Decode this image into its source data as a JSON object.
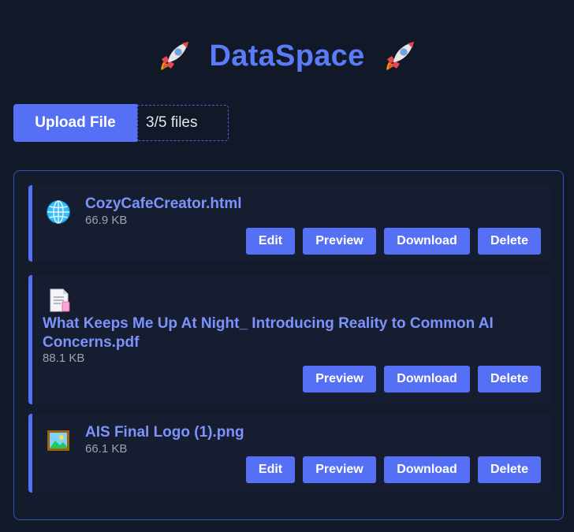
{
  "app": {
    "title": "DataSpace",
    "title_left_icon": "rocket-icon",
    "title_right_icon": "rocket-icon"
  },
  "upload": {
    "button_label": "Upload File",
    "file_count": "3/5 files"
  },
  "files": [
    {
      "icon": "globe-icon",
      "name": "CozyCafeCreator.html",
      "size": "66.9 KB",
      "actions": [
        "Edit",
        "Preview",
        "Download",
        "Delete"
      ]
    },
    {
      "icon": "document-icon",
      "name": "What Keeps Me Up At Night_ Introducing Reality to Common AI Concerns.pdf",
      "size": "88.1 KB",
      "actions": [
        "Preview",
        "Download",
        "Delete"
      ]
    },
    {
      "icon": "image-icon",
      "name": "AIS Final Logo (1).png",
      "size": "66.1 KB",
      "actions": [
        "Edit",
        "Preview",
        "Download",
        "Delete"
      ]
    }
  ],
  "colors": {
    "background": "#111827",
    "accent": "#5670f5",
    "title": "#5b7cfa",
    "file_name": "#7b93fb",
    "muted": "#9ca3af"
  }
}
